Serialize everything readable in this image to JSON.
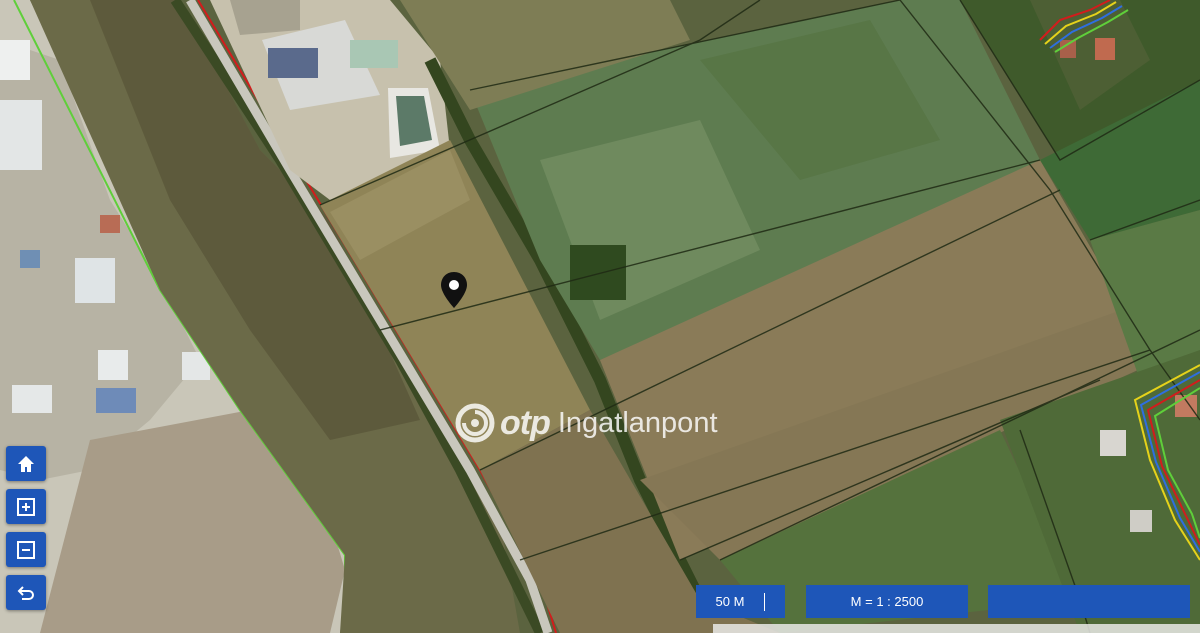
{
  "map": {
    "type": "satellite-cadastral-map",
    "marker_icon": "map-pin-icon"
  },
  "controls": [
    {
      "name": "home-button",
      "icon": "home-icon"
    },
    {
      "name": "zoom-in-button",
      "icon": "plus-square-icon"
    },
    {
      "name": "zoom-out-button",
      "icon": "minus-square-icon"
    },
    {
      "name": "back-button",
      "icon": "undo-arrow-icon"
    }
  ],
  "watermark": {
    "brand": "otp",
    "suffix": "Ingatlanpont"
  },
  "scale": {
    "distance": "50 M",
    "ratio": "M = 1 : 2500",
    "extra": ""
  },
  "colors": {
    "control_blue": "#1e56b8",
    "parcel_red": "#d21c1c",
    "boundary_green": "#5fcf3a"
  }
}
